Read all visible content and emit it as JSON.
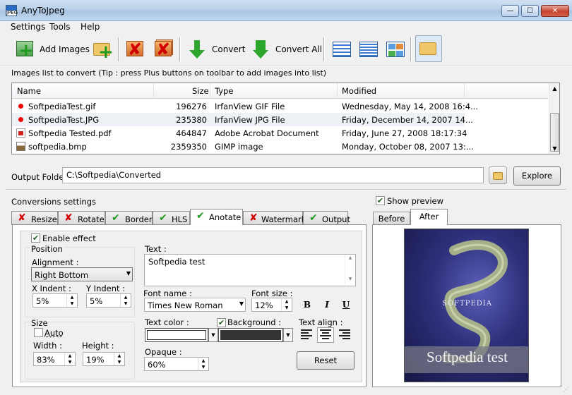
{
  "window": {
    "title": "AnyToJpeg",
    "icon_text": "JPEG",
    "min_label": "—",
    "max_label": "☐",
    "close_label": "✕"
  },
  "menu": [
    "Settings",
    "Tools",
    "Help"
  ],
  "toolbar": {
    "add_images": "Add Images",
    "convert": "Convert",
    "convert_all": "Convert All"
  },
  "list": {
    "caption": "Images list to convert   (Tip : press Plus buttons on toolbar to add images into list)",
    "headers": {
      "name": "Name",
      "size": "Size",
      "type": "Type",
      "modified": "Modified"
    },
    "rows": [
      {
        "name": "SoftpediaTest.gif",
        "size": "196276",
        "type": "IrfanView GIF File",
        "modified": "Wednesday, May 14, 2008 16:4...",
        "icon": "irfanview-icon"
      },
      {
        "name": "SoftpediaTest.JPG",
        "size": "235380",
        "type": "IrfanView JPG File",
        "modified": "Friday, December 14, 2007 14...",
        "icon": "irfanview-icon"
      },
      {
        "name": "Softpedia Tested.pdf",
        "size": "464847",
        "type": "Adobe Acrobat Document",
        "modified": "Friday, June 27, 2008 18:17:34",
        "icon": "pdf-icon"
      },
      {
        "name": "softpedia.bmp",
        "size": "2359350",
        "type": "GIMP image",
        "modified": "Monday, October 08, 2007 13:...",
        "icon": "gimp-icon"
      }
    ]
  },
  "output": {
    "label": "Output Folder",
    "path": "C:\\Softpedia\\Converted",
    "explore": "Explore"
  },
  "conversions": {
    "label": "Conversions settings",
    "tabs": [
      {
        "label": "Resize",
        "status": "✘"
      },
      {
        "label": "Rotate",
        "status": "✘"
      },
      {
        "label": "Border",
        "status": "✔"
      },
      {
        "label": "HLS",
        "status": "✔"
      },
      {
        "label": "Anotate",
        "status": "✔"
      },
      {
        "label": "Watermark",
        "status": "✘"
      },
      {
        "label": "Output",
        "status": "✔"
      }
    ],
    "active_tab": "Anotate"
  },
  "anotate": {
    "enable_effect": "Enable effect",
    "position": "Position",
    "alignment_label": "Alignment :",
    "alignment_value": "Right Bottom",
    "x_indent_label": "X Indent :",
    "x_indent": "5%",
    "y_indent_label": "Y Indent :",
    "y_indent": "5%",
    "size": "Size",
    "auto": "Auto",
    "width_label": "Width :",
    "width": "83%",
    "height_label": "Height :",
    "height": "19%",
    "text_label": "Text :",
    "text_value": "Softpedia test",
    "font_name_label": "Font name :",
    "font_name": "Times New Roman",
    "font_size_label": "Font size :",
    "font_size": "12%",
    "bold": "B",
    "italic": "I",
    "underline": "U",
    "text_color_label": "Text color :",
    "background_label": "Background :",
    "text_align_label": "Text align :",
    "opaque_label": "Opaque :",
    "opaque": "60%",
    "reset": "Reset",
    "colors": {
      "text": "#ffffff",
      "background": "#333333"
    }
  },
  "preview": {
    "show_preview": "Show preview",
    "before": "Before",
    "after": "After",
    "brand_text": "SOFTPEDIA",
    "overlay_text": "Softpedia test"
  }
}
